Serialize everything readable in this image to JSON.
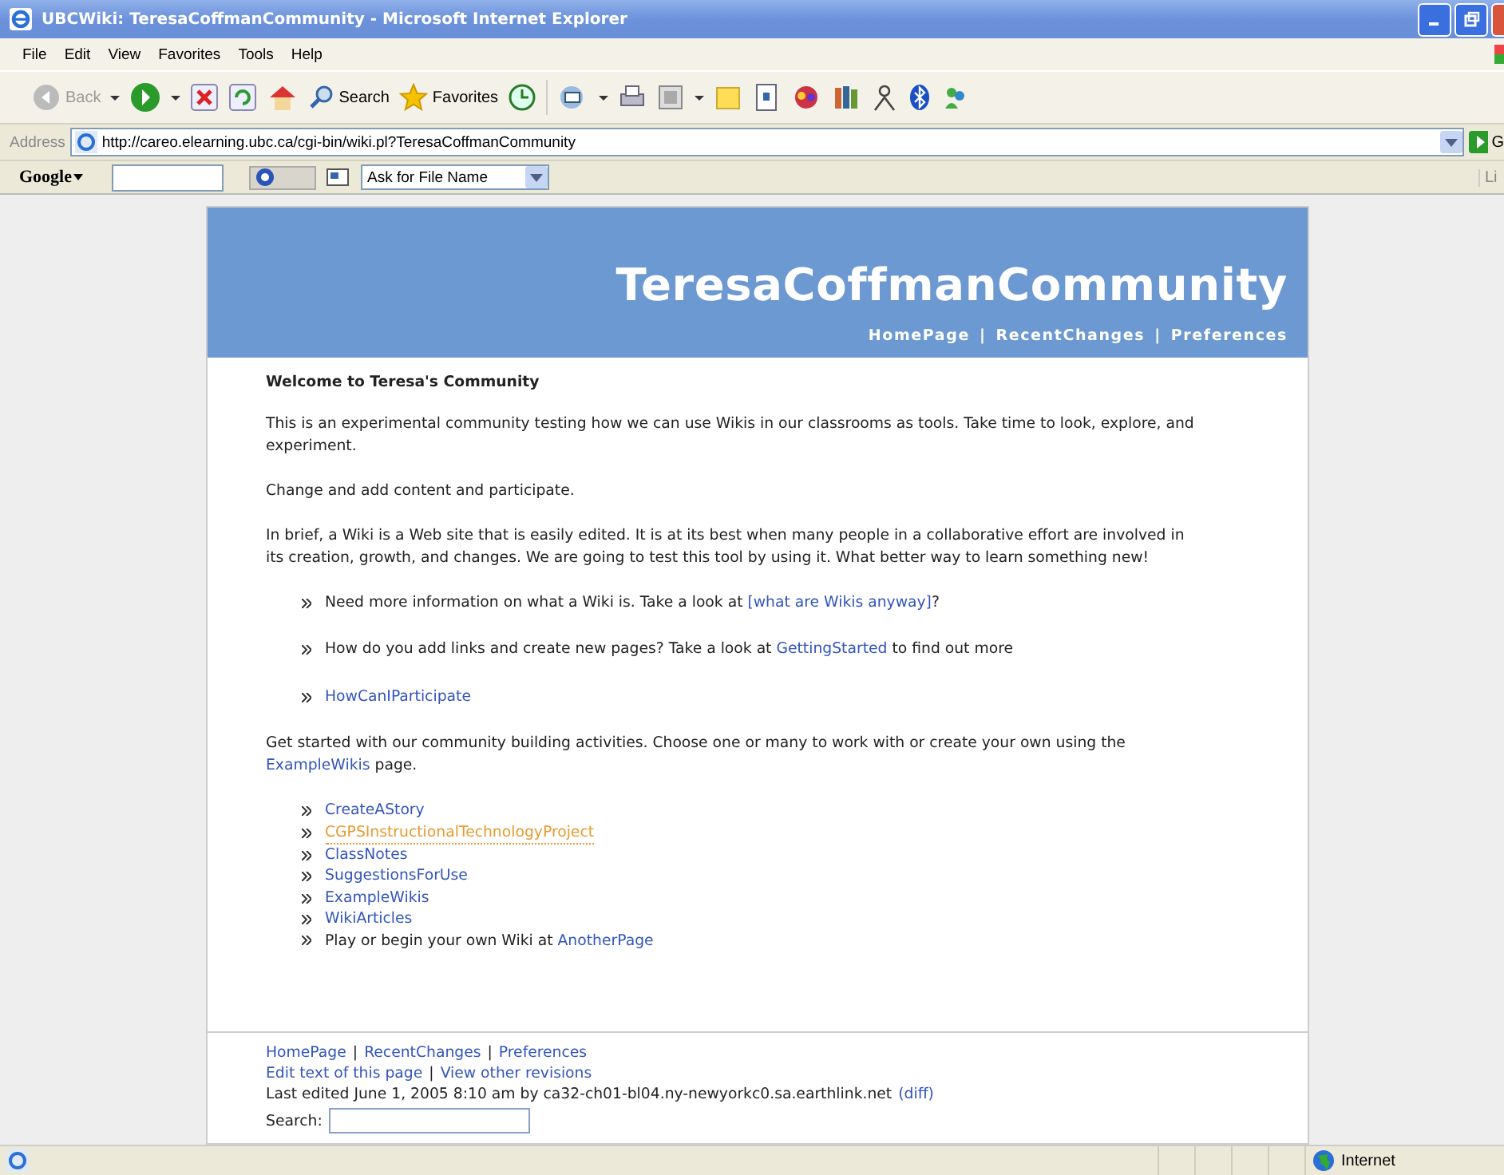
{
  "window": {
    "title": "UBCWiki: TeresaCoffmanCommunity - Microsoft Internet Explorer"
  },
  "menu": [
    "File",
    "Edit",
    "View",
    "Favorites",
    "Tools",
    "Help"
  ],
  "toolbar": {
    "back": "Back",
    "search": "Search",
    "favorites": "Favorites"
  },
  "address": {
    "label": "Address",
    "url": "http://careo.elearning.ubc.ca/cgi-bin/wiki.pl?TeresaCoffmanCommunity",
    "go": "G"
  },
  "google_bar": {
    "logo": "Google",
    "dropdown": "Ask for File Name",
    "links": "Li"
  },
  "page": {
    "title": "TeresaCoffmanCommunity",
    "nav": [
      {
        "kind": "link",
        "text": "HomePage"
      },
      {
        "kind": "sep",
        "text": "|"
      },
      {
        "kind": "link",
        "text": "RecentChanges"
      },
      {
        "kind": "sep",
        "text": "|"
      },
      {
        "kind": "link",
        "text": "Preferences"
      }
    ],
    "heading": "Welcome to Teresa's Community",
    "blocks": [
      {
        "kind": "para",
        "parts": [
          {
            "kind": "text",
            "text": "This is an experimental community testing how we can use Wikis in our classrooms as tools. Take time to look, explore, and experiment."
          }
        ]
      },
      {
        "kind": "para",
        "parts": [
          {
            "kind": "text",
            "text": "Change and add content and participate."
          }
        ]
      },
      {
        "kind": "para",
        "parts": [
          {
            "kind": "text",
            "text": "In brief, a Wiki is a Web site that is easily edited. It is at its best when many people in a collaborative effort are involved in its creation, growth, and changes. We are going to test this tool by using it. What better way to learn something new!"
          }
        ]
      },
      {
        "kind": "spaced-list",
        "items": [
          [
            {
              "kind": "text",
              "text": "Need more information on what a Wiki is. Take a look at "
            },
            {
              "kind": "link",
              "text": "[what are Wikis anyway]"
            },
            {
              "kind": "text",
              "text": "?"
            }
          ],
          [
            {
              "kind": "text",
              "text": "How do you add links and create new pages? Take a look at "
            },
            {
              "kind": "link",
              "text": "GettingStarted"
            },
            {
              "kind": "text",
              "text": " to find out more"
            }
          ],
          [
            {
              "kind": "link",
              "text": "HowCanIParticipate"
            }
          ]
        ]
      },
      {
        "kind": "para",
        "parts": [
          {
            "kind": "text",
            "text": "Get started with our community building activities. Choose one or many to work with or create your own using the "
          },
          {
            "kind": "link",
            "text": "ExampleWikis"
          },
          {
            "kind": "text",
            "text": " page."
          }
        ]
      },
      {
        "kind": "list",
        "items": [
          [
            {
              "kind": "link",
              "text": "CreateAStory"
            }
          ],
          [
            {
              "kind": "missing",
              "text": "CGPSInstructionalTechnologyProject"
            }
          ],
          [
            {
              "kind": "link",
              "text": "ClassNotes"
            }
          ],
          [
            {
              "kind": "link",
              "text": "SuggestionsForUse"
            }
          ],
          [
            {
              "kind": "link",
              "text": "ExampleWikis"
            }
          ],
          [
            {
              "kind": "link",
              "text": "WikiArticles"
            }
          ],
          [
            {
              "kind": "text",
              "text": "Play or begin your own Wiki at "
            },
            {
              "kind": "link",
              "text": "AnotherPage"
            }
          ]
        ]
      }
    ],
    "footer": {
      "nav": [
        {
          "kind": "link",
          "text": "HomePage"
        },
        {
          "kind": "sep",
          "text": "|"
        },
        {
          "kind": "link",
          "text": "RecentChanges"
        },
        {
          "kind": "sep",
          "text": "|"
        },
        {
          "kind": "link",
          "text": "Preferences"
        }
      ],
      "edit": [
        {
          "kind": "link",
          "text": "Edit text of this page"
        },
        {
          "kind": "sep",
          "text": "|"
        },
        {
          "kind": "link",
          "text": "View other revisions"
        }
      ],
      "last_edited": "Last edited June 1, 2005 8:10 am by ca32-ch01-bl04.ny-newyorkc0.sa.earthlink.net",
      "diff": "(diff)",
      "search_label": "Search:"
    }
  },
  "status_bar": {
    "zone": "Internet"
  }
}
